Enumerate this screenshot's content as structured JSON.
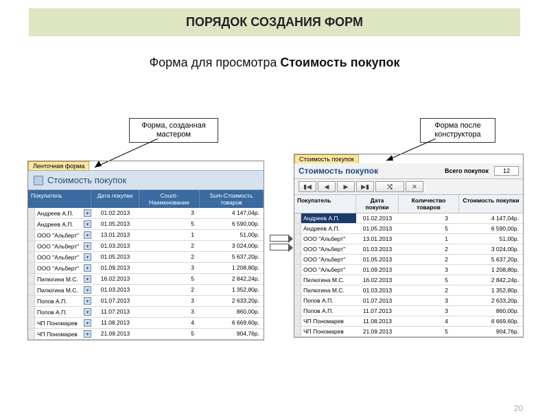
{
  "slide": {
    "title": "ПОРЯДОК СОЗДАНИЯ ФОРМ",
    "subtitle_prefix": "Форма для просмотра ",
    "subtitle_bold": "Стоимость покупок",
    "page_number": "20"
  },
  "callouts": {
    "left": "Форма, созданная мастером",
    "right": "Форма после конструктора"
  },
  "left_form": {
    "tab": "Ленточная форма",
    "title": "Стоимость покупок",
    "columns": {
      "buyer": "Покупатель",
      "date": "Дата покупки",
      "count": "Count-Наименование",
      "sum": "Sum-Стоимость товаров"
    },
    "rows": [
      {
        "buyer": "Андреев А.П.",
        "date": "01.02.2013",
        "count": "3",
        "sum": "4 147,04р."
      },
      {
        "buyer": "Андреев А.П.",
        "date": "01.05.2013",
        "count": "5",
        "sum": "6 590,00р."
      },
      {
        "buyer": "ООО \"Альберт\"",
        "date": "13.01.2013",
        "count": "1",
        "sum": "51,00р."
      },
      {
        "buyer": "ООО \"Альберт\"",
        "date": "01.03.2013",
        "count": "2",
        "sum": "3 024,00р."
      },
      {
        "buyer": "ООО \"Альберт\"",
        "date": "01.05.2013",
        "count": "2",
        "sum": "5 637,20р."
      },
      {
        "buyer": "ООО \"Альберт\"",
        "date": "01.09.2013",
        "count": "3",
        "sum": "1 208,80р."
      },
      {
        "buyer": "Пилюгина М.С.",
        "date": "16.02.2013",
        "count": "5",
        "sum": "2 842,24р."
      },
      {
        "buyer": "Пилюгина М.С.",
        "date": "01.03.2013",
        "count": "2",
        "sum": "1 352,80р."
      },
      {
        "buyer": "Попов А.П.",
        "date": "01.07.2013",
        "count": "3",
        "sum": "2 633,20р."
      },
      {
        "buyer": "Попов А.П.",
        "date": "11.07.2013",
        "count": "3",
        "sum": "860,00р."
      },
      {
        "buyer": "ЧП Пономарев",
        "date": "11.08.2013",
        "count": "4",
        "sum": "6 669,60р."
      },
      {
        "buyer": "ЧП Пономарев",
        "date": "21.09.2013",
        "count": "5",
        "sum": "904,76р."
      }
    ]
  },
  "right_form": {
    "tab": "Стоимость покупок",
    "title": "Стоимость покупок",
    "total_label": "Всего покупок",
    "total_value": "12",
    "nav": {
      "first": "▮◀",
      "prev": "◀",
      "next": "▶",
      "last": "▶▮",
      "filter": "⤭",
      "close": "✕"
    },
    "columns": {
      "buyer": "Покупатель",
      "date": "Дата покупки",
      "count": "Количество товаров",
      "sum": "Стоимость покупки"
    },
    "rows": [
      {
        "buyer": "Андреев А.П.",
        "date": "01.02.2013",
        "count": "3",
        "sum": "4 147,04р.",
        "highlight": true
      },
      {
        "buyer": "Андреев А.П.",
        "date": "01.05.2013",
        "count": "5",
        "sum": "6 590,00р."
      },
      {
        "buyer": "ООО \"Альберт\"",
        "date": "13.01.2013",
        "count": "1",
        "sum": "51,00р."
      },
      {
        "buyer": "ООО \"Альберт\"",
        "date": "01.03.2013",
        "count": "2",
        "sum": "3 024,00р."
      },
      {
        "buyer": "ООО \"Альберт\"",
        "date": "01.05.2013",
        "count": "2",
        "sum": "5 637,20р."
      },
      {
        "buyer": "ООО \"Альберт\"",
        "date": "01.09.2013",
        "count": "3",
        "sum": "1 208,80р."
      },
      {
        "buyer": "Пилюгина М.С.",
        "date": "16.02.2013",
        "count": "5",
        "sum": "2 842,24р."
      },
      {
        "buyer": "Пилюгина М.С.",
        "date": "01.03.2013",
        "count": "2",
        "sum": "1 352,80р."
      },
      {
        "buyer": "Попов А.П.",
        "date": "01.07.2013",
        "count": "3",
        "sum": "2 633,20р."
      },
      {
        "buyer": "Попов А.П.",
        "date": "11.07.2013",
        "count": "3",
        "sum": "860,00р."
      },
      {
        "buyer": "ЧП Пономарев",
        "date": "11.08.2013",
        "count": "4",
        "sum": "6 669,60р."
      },
      {
        "buyer": "ЧП Пономарев",
        "date": "21.09.2013",
        "count": "5",
        "sum": "904,76р."
      }
    ]
  }
}
